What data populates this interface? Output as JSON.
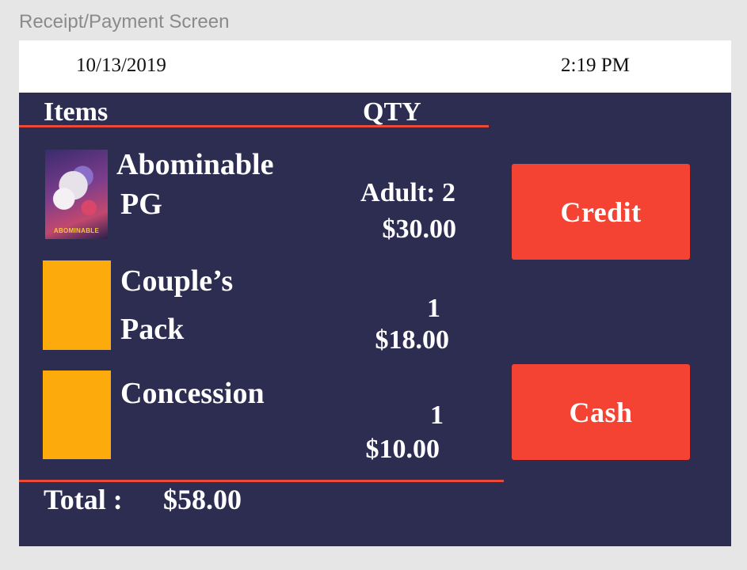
{
  "window": {
    "title": "Receipt/Payment Screen"
  },
  "header": {
    "date": "10/13/2019",
    "time": "2:19 PM"
  },
  "columns": {
    "items": "Items",
    "qty": "QTY"
  },
  "items": [
    {
      "name_line1": "Abominable",
      "name_line2": "PG",
      "qty": "Adult: 2",
      "price": "$30.00",
      "thumbnail": "abominable-poster",
      "poster_text": "ABOMINABLE"
    },
    {
      "name_line1": "Couple’s",
      "name_line2": "Pack",
      "qty": "1",
      "price": "$18.00",
      "thumbnail": "placeholder-orange"
    },
    {
      "name_line1": "Concession",
      "name_line2": "",
      "qty": "1",
      "price": "$10.00",
      "thumbnail": "placeholder-orange"
    }
  ],
  "total": {
    "label": "Total :",
    "amount": "$58.00"
  },
  "payment": {
    "credit_label": "Credit",
    "cash_label": "Cash"
  },
  "colors": {
    "panel": "#2d2d52",
    "accent": "#f44333",
    "divider": "#e94a3a",
    "placeholder": "#fcaa0c",
    "topbar": "#ffffff"
  }
}
